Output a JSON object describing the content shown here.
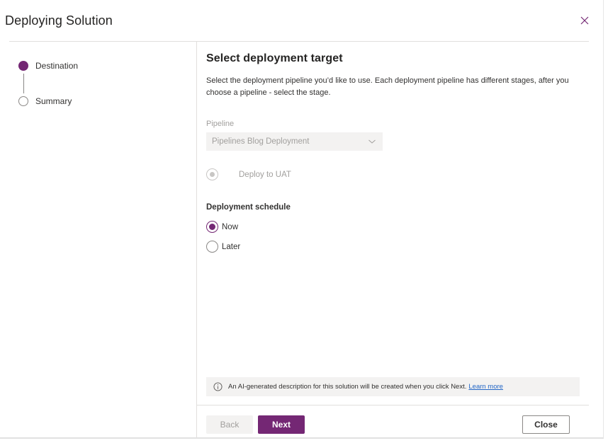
{
  "dialog": {
    "title": "Deploying Solution",
    "close_icon": "close-icon"
  },
  "steps": [
    {
      "label": "Destination",
      "state": "active"
    },
    {
      "label": "Summary",
      "state": "inactive"
    }
  ],
  "main": {
    "heading": "Select deployment target",
    "description": "Select the deployment pipeline you’d like to use. Each deployment pipeline has different stages, after you choose a pipeline - select the stage.",
    "pipeline": {
      "label": "Pipeline",
      "value": "Pipelines Blog Deployment",
      "disabled": true
    },
    "stage": {
      "label": "Deploy to UAT",
      "selected": true,
      "disabled": true
    },
    "schedule": {
      "label": "Deployment schedule",
      "options": [
        {
          "label": "Now",
          "selected": true
        },
        {
          "label": "Later",
          "selected": false
        }
      ]
    },
    "info": {
      "icon": "info-icon",
      "text": "An AI-generated description for this solution will be created when you click Next.",
      "link": "Learn more"
    }
  },
  "footer": {
    "back_label": "Back",
    "next_label": "Next",
    "close_label": "Close"
  },
  "colors": {
    "accent": "#742774",
    "link": "#2266c6",
    "disabled_bg": "#f3f2f1"
  }
}
